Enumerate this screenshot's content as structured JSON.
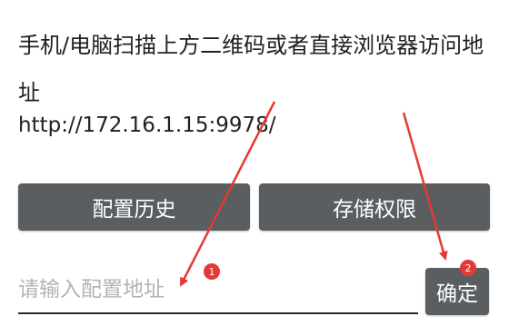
{
  "instruction_text": "手机/电脑扫描上方二维码或者直接浏览器访问地址",
  "address_url": "http://172.16.1.15:9978/",
  "buttons": {
    "config_history": "配置历史",
    "storage_permission": "存储权限",
    "confirm": "确定"
  },
  "config_input": {
    "placeholder": "请输入配置地址",
    "value": ""
  },
  "annotations": {
    "badge_1": "1",
    "badge_2": "2",
    "color": "#e53935"
  },
  "colors": {
    "button_bg": "#5b5e61",
    "text": "#212121",
    "placeholder": "#b3b3b3"
  }
}
